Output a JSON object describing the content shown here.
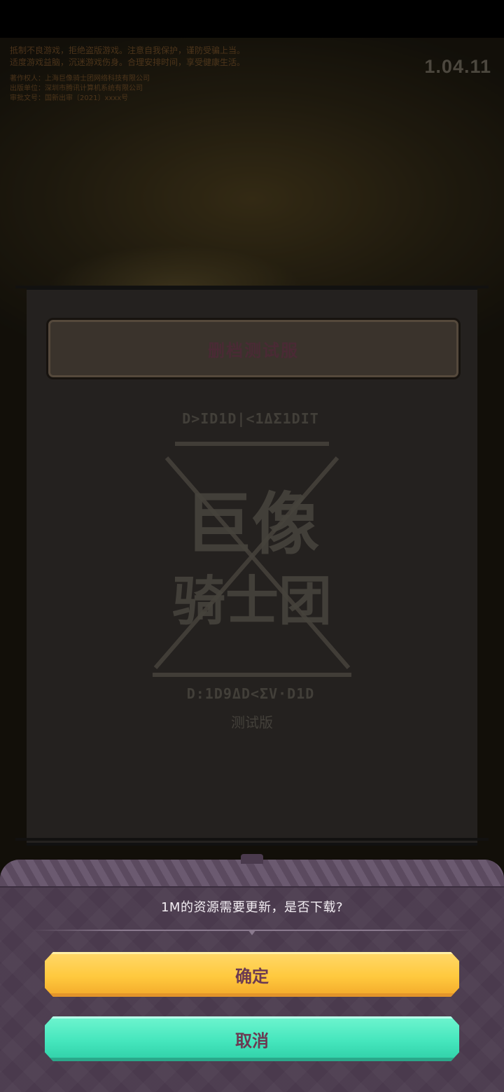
{
  "notice": {
    "lines": [
      "抵制不良游戏，拒绝盗版游戏。注意自我保护，谨防受骗上当。",
      "适度游戏益脑，沉迷游戏伤身。合理安排时间，享受健康生活。"
    ],
    "publish_lines": [
      "著作权人：上海巨像骑士团网络科技有限公司",
      "出版单位：深圳市腾讯计算机系统有限公司",
      "审批文号：国新出审〔2021〕xxxx号"
    ]
  },
  "version": "1.04.11",
  "server_banner": {
    "label": "删档测试服"
  },
  "logo": {
    "rune_top": "D>ID1D|<1ΔΣ1DIT",
    "title_line1": "巨像",
    "title_line2": "骑士团",
    "rune_bottom": "D:1D9ΔD<ΣV·D1D",
    "subtitle": "测试版"
  },
  "update_sheet": {
    "prompt": "1M的资源需要更新，是否下载?",
    "confirm_label": "确定",
    "cancel_label": "取消"
  },
  "colors": {
    "confirm_button": "#ffc93e",
    "cancel_button": "#45e6bd",
    "sheet_background": "#4a3a4d",
    "button_text": "#6b3a52"
  }
}
